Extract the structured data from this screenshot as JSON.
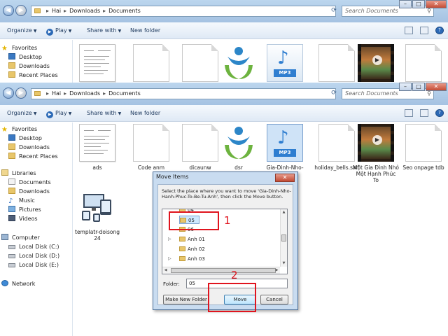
{
  "explorer": {
    "breadcrumb": [
      "Hai",
      "Downloads",
      "Documents"
    ],
    "search_placeholder": "Search Documents",
    "toolbar": {
      "organize": "Organize",
      "play": "Play",
      "share_with": "Share with",
      "new_folder": "New folder"
    },
    "nav": {
      "favorites_header": "Favorites",
      "favorites": [
        "Desktop",
        "Downloads",
        "Recent Places"
      ],
      "libraries_header": "Libraries",
      "libraries": [
        "Documents",
        "Downloads",
        "Music",
        "Pictures",
        "Videos"
      ],
      "computer_header": "Computer",
      "drives": [
        "Local Disk (C:)",
        "Local Disk (D:)",
        "Local Disk (E:)"
      ],
      "network": "Network"
    },
    "files": [
      {
        "name": "ads",
        "kind": "document"
      },
      {
        "name": "Code anm",
        "kind": "blank"
      },
      {
        "name": "dicaunw",
        "kind": "blank"
      },
      {
        "name": "dsr",
        "kind": "logo"
      },
      {
        "name": "Gia-Dinh-Nho-H...-Be",
        "kind": "mp3"
      },
      {
        "name": "holiday_bells.swf",
        "kind": "blank"
      },
      {
        "name": "Một Gia Đình Nhỏ Một Hạnh Phúc To",
        "kind": "video"
      },
      {
        "name": "Seo onpage tdb",
        "kind": "blank"
      },
      {
        "name": "templatr-doisong 24",
        "kind": "devices"
      }
    ]
  },
  "dialog": {
    "title": "Move Items",
    "close_label": "✕",
    "instruction": "Select the place where you want to move 'Gia-Dinh-Nho-Hanh-Phuc-To-Be-Tu-Anh', then click the Move button.",
    "tree": [
      {
        "label": "04",
        "expander": ""
      },
      {
        "label": "05",
        "expander": "",
        "selected": true
      },
      {
        "label": "06",
        "expander": ""
      },
      {
        "label": "Anh 01",
        "expander": "▷"
      },
      {
        "label": "Anh 02",
        "expander": ""
      },
      {
        "label": "Anh 03",
        "expander": "▷"
      }
    ],
    "folder_label": "Folder:",
    "folder_value": "05",
    "new_folder_button": "Make New Folder",
    "move_button": "Move",
    "cancel_button": "Cancel"
  },
  "annotations": {
    "step1": "1",
    "step2": "2",
    "color": "#e0141e"
  }
}
